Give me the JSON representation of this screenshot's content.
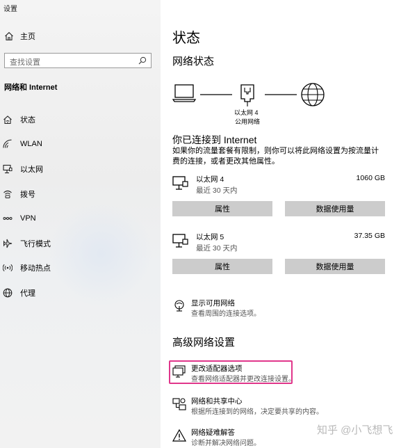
{
  "window": {
    "title": "设置"
  },
  "sidebar": {
    "home_label": "主页",
    "search_placeholder": "查找设置",
    "section_title": "网络和 Internet",
    "items": [
      {
        "label": "状态",
        "icon": "home-wifi-icon"
      },
      {
        "label": "WLAN",
        "icon": "wifi-icon"
      },
      {
        "label": "以太网",
        "icon": "ethernet-icon"
      },
      {
        "label": "拨号",
        "icon": "dialup-icon"
      },
      {
        "label": "VPN",
        "icon": "vpn-icon"
      },
      {
        "label": "飞行模式",
        "icon": "airplane-icon"
      },
      {
        "label": "移动热点",
        "icon": "hotspot-icon"
      },
      {
        "label": "代理",
        "icon": "globe-icon"
      }
    ]
  },
  "main": {
    "page_title": "状态",
    "network_status_title": "网络状态",
    "diagram": {
      "adapter_name": "以太网 4",
      "network_type": "公用网络"
    },
    "connected_title": "你已连接到 Internet",
    "connected_desc": "如果你的流量套餐有限制，则你可以将此网络设置为按流量计费的连接，或者更改其他属性。",
    "connections": [
      {
        "name": "以太网 4",
        "status": "最近 30 天内",
        "usage": "1060 GB",
        "properties_label": "属性",
        "data_usage_label": "数据使用量"
      },
      {
        "name": "以太网 5",
        "status": "最近 30 天内",
        "usage": "37.35 GB",
        "properties_label": "属性",
        "data_usage_label": "数据使用量"
      }
    ],
    "show_networks": {
      "title": "显示可用网络",
      "subtitle": "查看周围的连接选项。"
    },
    "advanced_title": "高级网络设置",
    "advanced_items": [
      {
        "title": "更改适配器选项",
        "subtitle": "查看网络适配器并更改连接设置。",
        "icon": "adapter-icon"
      },
      {
        "title": "网络和共享中心",
        "subtitle": "根据所连接到的网络，决定要共享的内容。",
        "icon": "sharing-center-icon"
      },
      {
        "title": "网络疑难解答",
        "subtitle": "诊断并解决网络问题。",
        "icon": "warning-icon"
      }
    ],
    "highlight_color": "#e0368b"
  },
  "watermark": "知乎 @小飞想飞"
}
